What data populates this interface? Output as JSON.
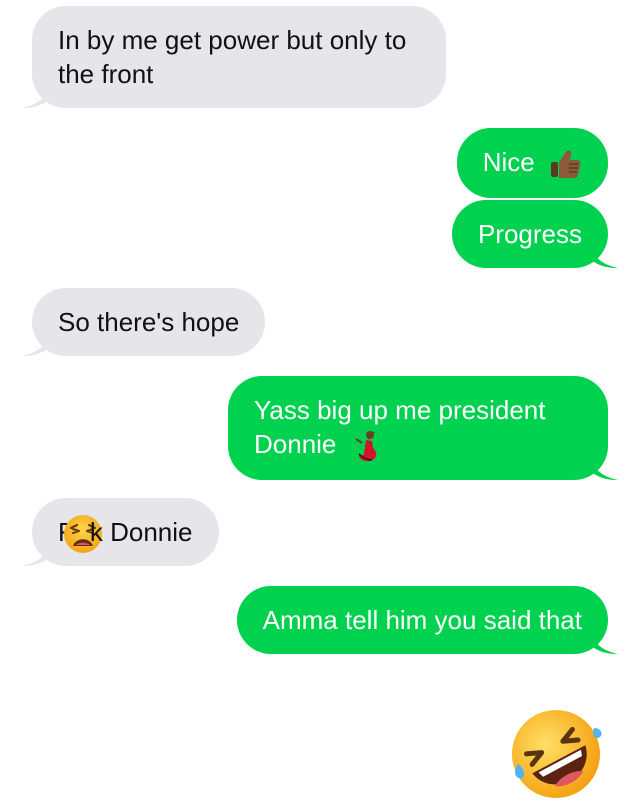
{
  "conversation": {
    "messages": [
      {
        "direction": "incoming",
        "text": "In by me get power but only to the front"
      },
      {
        "direction": "outgoing",
        "text": "Nice",
        "emoji": "thumbs-up-icon"
      },
      {
        "direction": "outgoing",
        "text": "Progress"
      },
      {
        "direction": "incoming",
        "text": "So there's hope"
      },
      {
        "direction": "outgoing",
        "text_line1": "Yass big up me president",
        "text_line2": "Donnie",
        "emoji": "dancer-icon"
      },
      {
        "direction": "incoming",
        "prefix": "F",
        "suffix": "k Donnie",
        "emoji": "weary-face-icon"
      },
      {
        "direction": "outgoing",
        "text": "Amma tell him you said that"
      }
    ],
    "final_emoji": "rolling-on-floor-laughing-icon"
  },
  "colors": {
    "incoming_bubble": "#e5e5ea",
    "outgoing_bubble": "#00d14e",
    "incoming_text": "#111111",
    "outgoing_text": "#ffffff"
  }
}
